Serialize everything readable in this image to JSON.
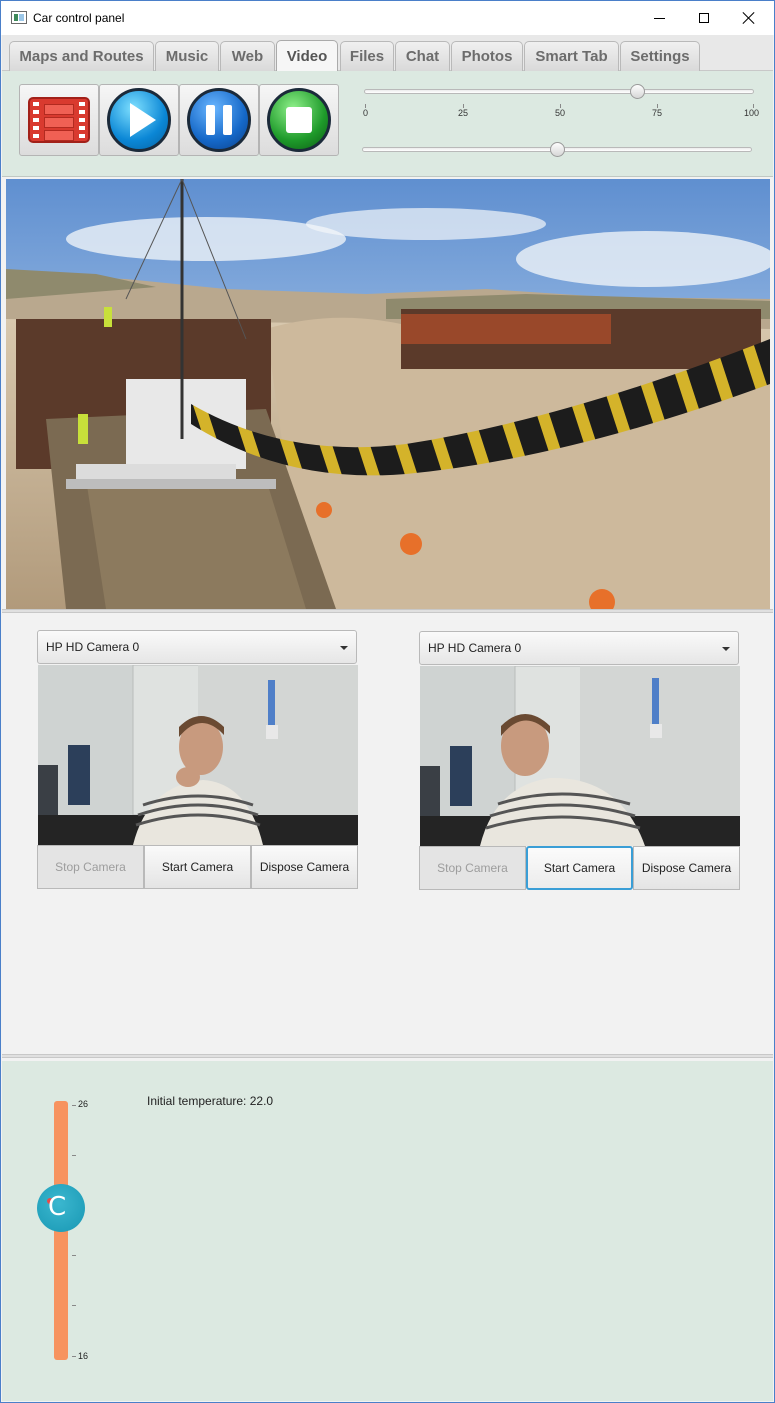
{
  "window": {
    "title": "Car control panel"
  },
  "tabs": [
    {
      "label": "Maps and Routes",
      "active": false
    },
    {
      "label": "Music",
      "active": false
    },
    {
      "label": "Web",
      "active": false
    },
    {
      "label": "Video",
      "active": true
    },
    {
      "label": "Files",
      "active": false
    },
    {
      "label": "Chat",
      "active": false
    },
    {
      "label": "Photos",
      "active": false
    },
    {
      "label": "Smart Tab",
      "active": false
    },
    {
      "label": "Settings",
      "active": false
    }
  ],
  "player": {
    "buttons": [
      "film-icon",
      "play-icon",
      "pause-icon",
      "stop-icon"
    ],
    "progress_slider": {
      "ticks": [
        "0",
        "25",
        "50",
        "75",
        "100"
      ],
      "value": 70
    },
    "volume_slider": {
      "value": 50
    }
  },
  "cameras": [
    {
      "selected": "HP HD Camera 0",
      "buttons": {
        "stop": "Stop Camera",
        "start": "Start Camera",
        "dispose": "Dispose Camera"
      },
      "stop_disabled": true,
      "start_focused": false
    },
    {
      "selected": "HP HD Camera 0",
      "buttons": {
        "stop": "Stop Camera",
        "start": "Start Camera",
        "dispose": "Dispose Camera"
      },
      "stop_disabled": true,
      "start_focused": true
    }
  ],
  "temperature": {
    "max_label": "26",
    "min_label": "16",
    "info": "Initial temperature: 22.0",
    "knob_glyph": "C",
    "value": 22.0,
    "min": 16,
    "max": 26
  },
  "colors": {
    "panel_bg": "#dce9e1",
    "temp_track": "#f7935f",
    "knob": "#1897b3",
    "focus": "#3a9ed6"
  }
}
